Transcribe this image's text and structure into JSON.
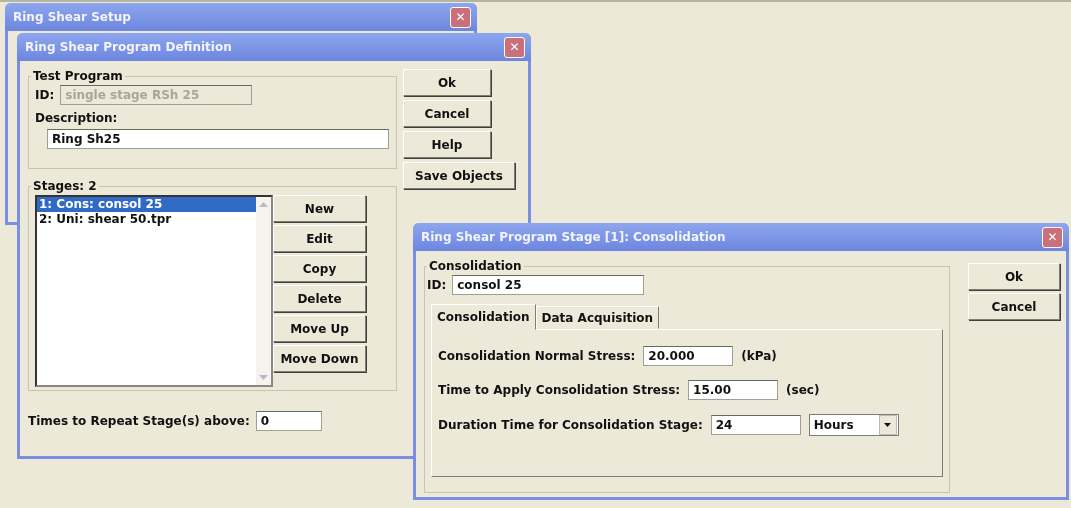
{
  "windows": [
    {
      "title": "Ring Shear Setup",
      "close": "✕"
    },
    {
      "title": "Ring Shear Program Definition",
      "close": "✕",
      "test_program": {
        "legend": "Test Program",
        "id_label": "ID:",
        "id_value": "single stage RSh 25",
        "id_disabled": true,
        "description_label": "Description:",
        "description_value": "Ring Sh25"
      },
      "buttons": [
        "Ok",
        "Cancel",
        "Help",
        "Save Objects"
      ],
      "stages": {
        "legend": "Stages: 2",
        "items": [
          {
            "label": "1: Cons: consol 25",
            "selected": true
          },
          {
            "label": "2: Uni: shear 50.tpr",
            "selected": false
          }
        ],
        "buttons": [
          "New",
          "Edit",
          "Copy",
          "Delete",
          "Move Up",
          "Move Down"
        ]
      },
      "repeat": {
        "label": "Times to Repeat Stage(s) above:",
        "value": "0"
      }
    },
    {
      "title": "Ring Shear Program Stage [1]: Consolidation",
      "close": "✕",
      "group": {
        "legend": "Consolidation",
        "id_label": "ID:",
        "id_value": "consol 25"
      },
      "tabs": [
        {
          "label": "Consolidation",
          "selected": true
        },
        {
          "label": "Data Acquisition",
          "selected": false
        }
      ],
      "fields": [
        {
          "label": "Consolidation Normal Stress:",
          "value": "20.000",
          "unit": "(kPa)",
          "kind": "unit"
        },
        {
          "label": "Time to Apply Consolidation Stress:",
          "value": "15.00",
          "unit": "(sec)",
          "kind": "unit"
        },
        {
          "label": "Duration Time for Consolidation Stage:",
          "value": "24",
          "unit": "Hours",
          "kind": "dropdown"
        }
      ],
      "buttons": [
        "Ok",
        "Cancel"
      ]
    }
  ]
}
